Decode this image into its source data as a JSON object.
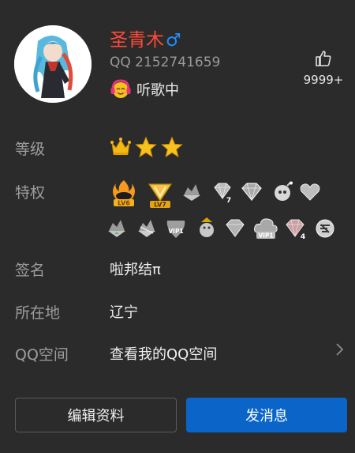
{
  "profile": {
    "nickname": "圣青木",
    "gender_symbol": "♂",
    "qq_number": "QQ 2152741659",
    "status": "听歌中",
    "likes": "9999+"
  },
  "rows": {
    "level_label": "等级",
    "privilege_label": "特权",
    "signature_label": "签名",
    "signature_value": "啦邦结π",
    "location_label": "所在地",
    "location_value": "辽宁",
    "qzone_label": "QQ空间",
    "qzone_value": "查看我的QQ空间"
  },
  "privilege_badge_text": {
    "lv6": "LV6",
    "lv7": "LV7",
    "diamond_7": "7",
    "vip1": "VIP1",
    "vip1_cloud": "VIP1",
    "diamond_4": "4"
  },
  "buttons": {
    "edit": "编辑资料",
    "message": "发消息"
  },
  "colors": {
    "background": "#2b2b2b",
    "nickname": "#ff4a3a",
    "gender": "#1e90ff",
    "primary_button": "#0b64c8",
    "crown": "#f5b914",
    "star": "#f7c21c"
  },
  "icons": {
    "status": "headphones-emoji-icon",
    "like": "thumbs-up-icon",
    "chevron": "chevron-right-icon"
  }
}
